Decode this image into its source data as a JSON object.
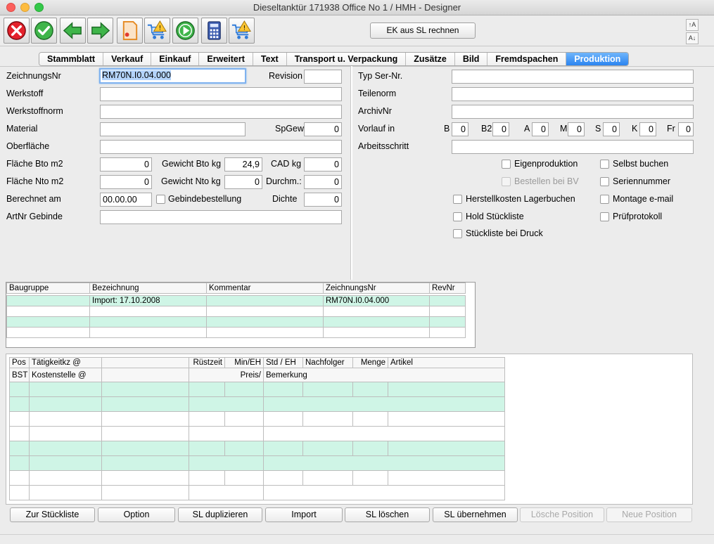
{
  "window": {
    "title": "Dieseltanktür  171938 Office No 1 /  HMH - Designer"
  },
  "toolbar": {
    "ek_button": "EK aus SL rechnen",
    "font_up": "↑A",
    "font_down": "A↓"
  },
  "tabs": [
    {
      "label": "Stammblatt"
    },
    {
      "label": "Verkauf"
    },
    {
      "label": "Einkauf"
    },
    {
      "label": "Erweitert"
    },
    {
      "label": "Text"
    },
    {
      "label": "Transport u. Verpackung"
    },
    {
      "label": "Zusätze"
    },
    {
      "label": "Bild"
    },
    {
      "label": "Fremdspachen"
    },
    {
      "label": "Produktion"
    }
  ],
  "active_tab": "Produktion",
  "left_form": {
    "zeichnungsnr_label": "ZeichnungsNr",
    "zeichnungsnr_value": "RM70N.I0.04.000",
    "revision_label": "Revision",
    "revision_value": "",
    "werkstoff_label": "Werkstoff",
    "werkstoffnorm_label": "Werkstoffnorm",
    "material_label": "Material",
    "spgew_label": "SpGew",
    "spgew_value": "0",
    "oberflaeche_label": "Oberfläche",
    "flaeche_bto_label": "Fläche Bto m2",
    "flaeche_bto_value": "0",
    "gewicht_bto_label": "Gewicht Bto kg",
    "gewicht_bto_value": "24,9",
    "cad_label": "CAD kg",
    "cad_value": "0",
    "flaeche_nto_label": "Fläche Nto m2",
    "flaeche_nto_value": "0",
    "gewicht_nto_label": "Gewicht Nto kg",
    "gewicht_nto_value": "0",
    "durchm_label": "Durchm.:",
    "durchm_value": "0",
    "berechnet_label": "Berechnet am",
    "berechnet_value": "00.00.00",
    "gebinde_label": "Gebindebestellung",
    "dichte_label": "Dichte",
    "dichte_value": "0",
    "artnr_label": "ArtNr Gebinde"
  },
  "right_form": {
    "typ_label": "Typ Ser-Nr.",
    "teilenorm_label": "Teilenorm",
    "archivnr_label": "ArchivNr",
    "vorlauf_label": "Vorlauf in",
    "vorlauf": [
      {
        "key": "B",
        "value": "0"
      },
      {
        "key": "B2",
        "value": "0"
      },
      {
        "key": "A",
        "value": "0"
      },
      {
        "key": "M",
        "value": "0"
      },
      {
        "key": "S",
        "value": "0"
      },
      {
        "key": "K",
        "value": "0"
      },
      {
        "key": "Fr",
        "value": "0"
      }
    ],
    "arbeitsschritt_label": "Arbeitsschritt",
    "checks": {
      "eigenproduktion": "Eigenproduktion",
      "selbst_buchen": "Selbst buchen",
      "bestellen_bei_bv": "Bestellen bei BV",
      "seriennummer": "Seriennummer",
      "herstellkosten": "Herstellkosten Lagerbuchen",
      "montage_email": "Montage e-mail",
      "hold_stueckliste": "Hold Stückliste",
      "pruefprotokoll": "Prüfprotokoll",
      "stueckliste_druck": "Stückliste bei Druck"
    }
  },
  "sl_table": {
    "headers": [
      "Baugruppe",
      "Bezeichnung",
      "Kommentar",
      "ZeichnungsNr",
      "RevNr"
    ],
    "rows": [
      [
        "",
        "Import: 17.10.2008",
        "",
        "RM70N.I0.04.000",
        ""
      ]
    ]
  },
  "op_table": {
    "header1": [
      "Pos",
      "Tätigkeitkz @",
      "",
      "Rüstzeit",
      "Min/EH",
      "Std / EH",
      "Nachfolger",
      "Menge",
      "Artikel"
    ],
    "header2": [
      "BST",
      "Kostenstelle @",
      "Preis/",
      "Bemerkung"
    ]
  },
  "buttons": {
    "zur_stueckliste": "Zur Stückliste",
    "option": "Option",
    "sl_duplizieren": "SL duplizieren",
    "import": "Import",
    "sl_loeschen": "SL löschen",
    "sl_uebernehmen": "SL übernehmen",
    "loesche_position": "Lösche Position",
    "neue_position": "Neue Position"
  }
}
